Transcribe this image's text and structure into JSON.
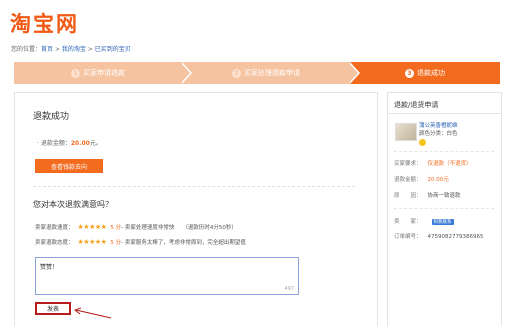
{
  "header": {
    "logo": "淘宝网"
  },
  "breadcrumb": {
    "prefix": "您的位置：",
    "items": [
      "首页",
      "我的淘宝",
      "已买到的宝贝"
    ],
    "sep": " > "
  },
  "steps": [
    {
      "num": "1",
      "label": "买家申请退款"
    },
    {
      "num": "2",
      "label": "买家处理退款申请"
    },
    {
      "num": "3",
      "label": "退款成功"
    }
  ],
  "main": {
    "title": "退款成功",
    "amount_label": "· 退款金额：",
    "amount_value": "20.00",
    "amount_unit": "元。",
    "funds_button": "查看钱款去向",
    "question": "您对本次退款满意吗？",
    "ratings": [
      {
        "label": "卖家退款速度：",
        "stars": "★★★★★",
        "score": "5 分",
        "desc": "- 卖家处理速度非常快",
        "note": "（退款历时4分50秒）"
      },
      {
        "label": "卖家退款态度：",
        "stars": "★★★★★",
        "score": "5 分",
        "desc": "- 卖家服务太棒了，考虑非常周到，完全超出期望值",
        "note": ""
      }
    ],
    "comment_text": "赞赞！",
    "char_count": "497",
    "publish_button": "发表"
  },
  "sidebar": {
    "title": "退款/退货申请",
    "product_name": "蒲公英香橙妮维",
    "product_color": "颜色分类：白色",
    "rows": [
      {
        "key": "买家要求：",
        "value": "仅退款（不退货）",
        "style": "orange"
      },
      {
        "key": "退款金额：",
        "value": "20.00元",
        "style": "orange"
      },
      {
        "key": "原　　因：",
        "value": "协商一致退款",
        "style": "plain"
      },
      {
        "key": "卖　　家：",
        "value": "",
        "badge": "和我联系",
        "style": "plain"
      },
      {
        "key": "订单编号：",
        "value": "4759082779386965",
        "style": "plain"
      }
    ]
  }
}
